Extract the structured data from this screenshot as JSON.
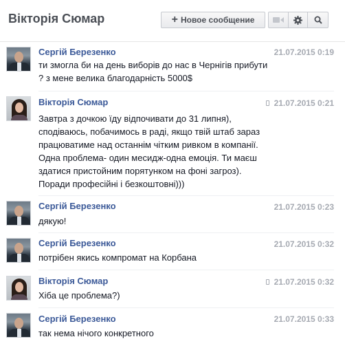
{
  "header": {
    "title": "Вікторія Сюмар",
    "new_message_label": "Новое сообщение"
  },
  "messages": [
    {
      "author": "Сергій Березенко",
      "time": "21.07.2015 0:19",
      "mobile": false,
      "lines": [
        "ти змогла би на день виборів до нас в Чернігів прибути",
        "? з мене велика благодарність 5000$"
      ]
    },
    {
      "author": "Вікторія Сюмар",
      "time": "21.07.2015 0:21",
      "mobile": true,
      "lines": [
        "Завтра з дочкою їду відпочивати до 31 липня),",
        "сподіваюсь, побачимось в раді, якщо твій штаб зараз",
        "працюватиме над останнім чітким ривком в компанії.",
        "Одна проблема- один месидж-одна емоція. Ти маєш",
        "здатися пристойним порятунком на фоні загроз).",
        "Поради професійні і безкоштовні)))"
      ]
    },
    {
      "author": "Сергій Березенко",
      "time": "21.07.2015 0:23",
      "mobile": false,
      "lines": [
        "дякую!"
      ]
    },
    {
      "author": "Сергій Березенко",
      "time": "21.07.2015 0:32",
      "mobile": false,
      "lines": [
        "потрібен якись компромат на Корбана"
      ]
    },
    {
      "author": "Вікторія Сюмар",
      "time": "21.07.2015 0:32",
      "mobile": true,
      "lines": [
        "Хіба це проблема?)"
      ]
    },
    {
      "author": "Сергій Березенко",
      "time": "21.07.2015 0:33",
      "mobile": false,
      "lines": [
        "так нема нічого конкретного"
      ]
    }
  ]
}
